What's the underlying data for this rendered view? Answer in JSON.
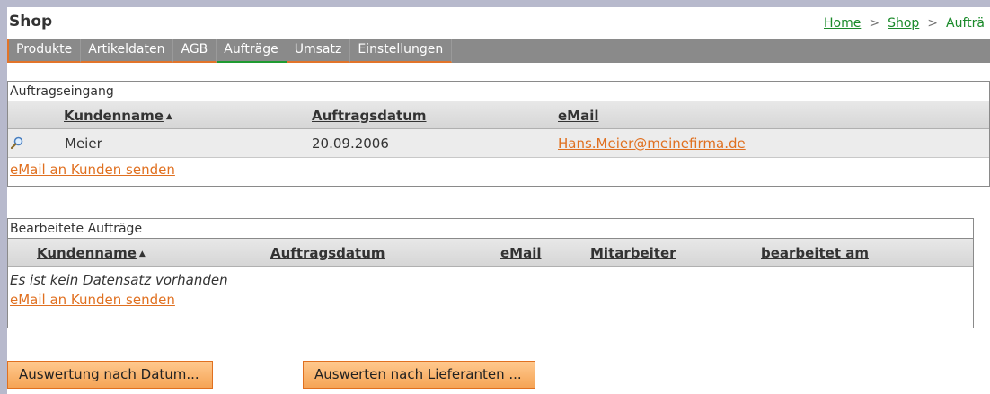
{
  "app": {
    "title": "Shop"
  },
  "breadcrumb": {
    "items": [
      "Home",
      "Shop",
      "Aufträ"
    ],
    "separator": ">"
  },
  "tabs": [
    {
      "label": "Produkte",
      "active": false
    },
    {
      "label": "Artikeldaten",
      "active": false
    },
    {
      "label": "AGB",
      "active": false
    },
    {
      "label": "Aufträge",
      "active": true
    },
    {
      "label": "Umsatz",
      "active": false
    },
    {
      "label": "Einstellungen",
      "active": false
    }
  ],
  "incoming": {
    "title": "Auftragseingang",
    "columns": [
      "Kundenname",
      "Auftragsdatum",
      "eMail"
    ],
    "rows": [
      {
        "icon": "magnifier-icon",
        "customer": "Meier",
        "date": "20.09.2006",
        "email": "Hans.Meier@meinefirma.de"
      }
    ],
    "footer_link": "eMail an Kunden senden"
  },
  "processed": {
    "title": "Bearbeitete Aufträge",
    "columns": [
      "Kundenname",
      "Auftragsdatum",
      "eMail",
      "Mitarbeiter",
      "bearbeitet am"
    ],
    "empty_message": "Es ist kein Datensatz vorhanden",
    "footer_link": "eMail an Kunden senden"
  },
  "buttons": {
    "by_date": "Auswertung nach Datum...",
    "by_supplier": "Auswerten nach Lieferanten ..."
  },
  "colors": {
    "accent": "#e07020",
    "active_tab": "#1f9b32",
    "tabbar": "#8a8a8a",
    "link_green": "#1a8a2a"
  }
}
